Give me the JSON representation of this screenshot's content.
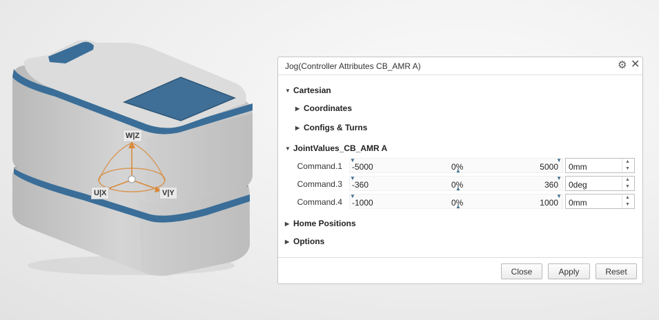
{
  "gizmo": {
    "labels": {
      "wz": "W|Z",
      "ux": "U|X",
      "vy": "V|Y"
    }
  },
  "panel": {
    "title": "Jog(Controller Attributes CB_AMR A)",
    "icons": {
      "settings": "gear-icon",
      "close": "close-icon"
    },
    "sections": {
      "cartesian": "Cartesian",
      "coordinates": "Coordinates",
      "configs": "Configs & Turns",
      "joint_values": "JointValues_CB_AMR A",
      "home_positions": "Home Positions",
      "options": "Options"
    },
    "commands": [
      {
        "label": "Command.1",
        "min": "-5000",
        "percent": "0%",
        "max": "5000",
        "value": "0mm"
      },
      {
        "label": "Command.3",
        "min": "-360",
        "percent": "0%",
        "max": "360",
        "value": "0deg"
      },
      {
        "label": "Command.4",
        "min": "-1000",
        "percent": "0%",
        "max": "1000",
        "value": "0mm"
      }
    ],
    "buttons": {
      "close": "Close",
      "apply": "Apply",
      "reset": "Reset"
    }
  },
  "colors": {
    "accent": "#3d6e8f",
    "gizmo": "#d98a3a",
    "model_trim": "#3a6e98"
  }
}
